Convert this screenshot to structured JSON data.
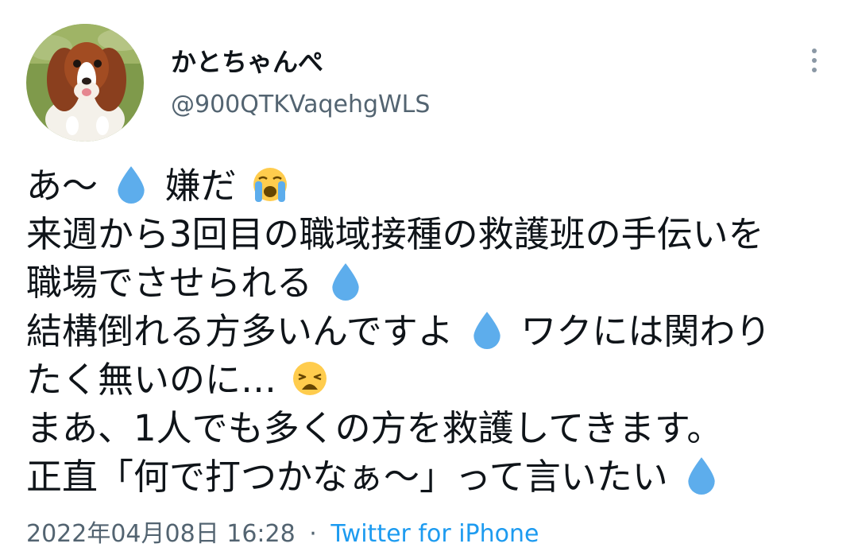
{
  "user": {
    "display_name": "かとちゃんぺ",
    "handle": "@900QTKVaqehgWLS"
  },
  "tweet": {
    "lines": [
      [
        "あ〜",
        "嫌だ"
      ],
      [
        "来週から3回目の職域接種の救護班の手伝いを"
      ],
      [
        "職場でさせられる"
      ],
      [
        "結構倒れる方多いんですよ",
        "ワクには関わり"
      ],
      [
        "たく無いのに…"
      ],
      [
        "まあ、1人でも多くの方を救護してきます。"
      ],
      [
        "正直「何で打つかなぁ〜」って言いたい"
      ]
    ],
    "emojis": {
      "sweat": "droplet-emoji",
      "crying": "loudly-crying-face-emoji",
      "weary": "weary-face-emoji"
    },
    "timestamp": "2022年04月08日 16:28",
    "separator": "·",
    "source": "Twitter for iPhone"
  },
  "colors": {
    "text": "#0f1419",
    "secondary": "#536471",
    "link": "#1d9bf0",
    "droplet": "#5dadec"
  }
}
